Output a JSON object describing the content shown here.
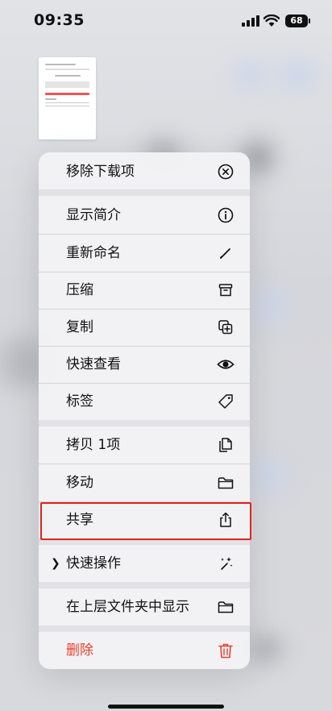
{
  "status_bar": {
    "time": "09:35",
    "battery": "68"
  },
  "menu": {
    "groups": [
      [
        {
          "label": "移除下载项",
          "icon": "x-circle-icon"
        }
      ],
      [
        {
          "label": "显示简介",
          "icon": "info-circle-icon"
        },
        {
          "label": "重新命名",
          "icon": "pencil-icon"
        },
        {
          "label": "压缩",
          "icon": "archive-box-icon"
        },
        {
          "label": "复制",
          "icon": "duplicate-icon"
        },
        {
          "label": "快速查看",
          "icon": "eye-icon"
        },
        {
          "label": "标签",
          "icon": "tag-icon"
        }
      ],
      [
        {
          "label": "拷贝 1项",
          "icon": "copy-doc-icon"
        },
        {
          "label": "移动",
          "icon": "folder-icon"
        },
        {
          "label": "共享",
          "icon": "share-icon",
          "highlighted": true
        }
      ],
      [
        {
          "label": "快速操作",
          "icon": "sparkles-icon",
          "expandable": true
        }
      ],
      [
        {
          "label": "在上层文件夹中显示",
          "icon": "folder-icon"
        }
      ],
      [
        {
          "label": "删除",
          "icon": "trash-icon",
          "destructive": true
        }
      ]
    ]
  },
  "colors": {
    "destructive": "#e8412f",
    "highlight_box": "#e0241c"
  }
}
